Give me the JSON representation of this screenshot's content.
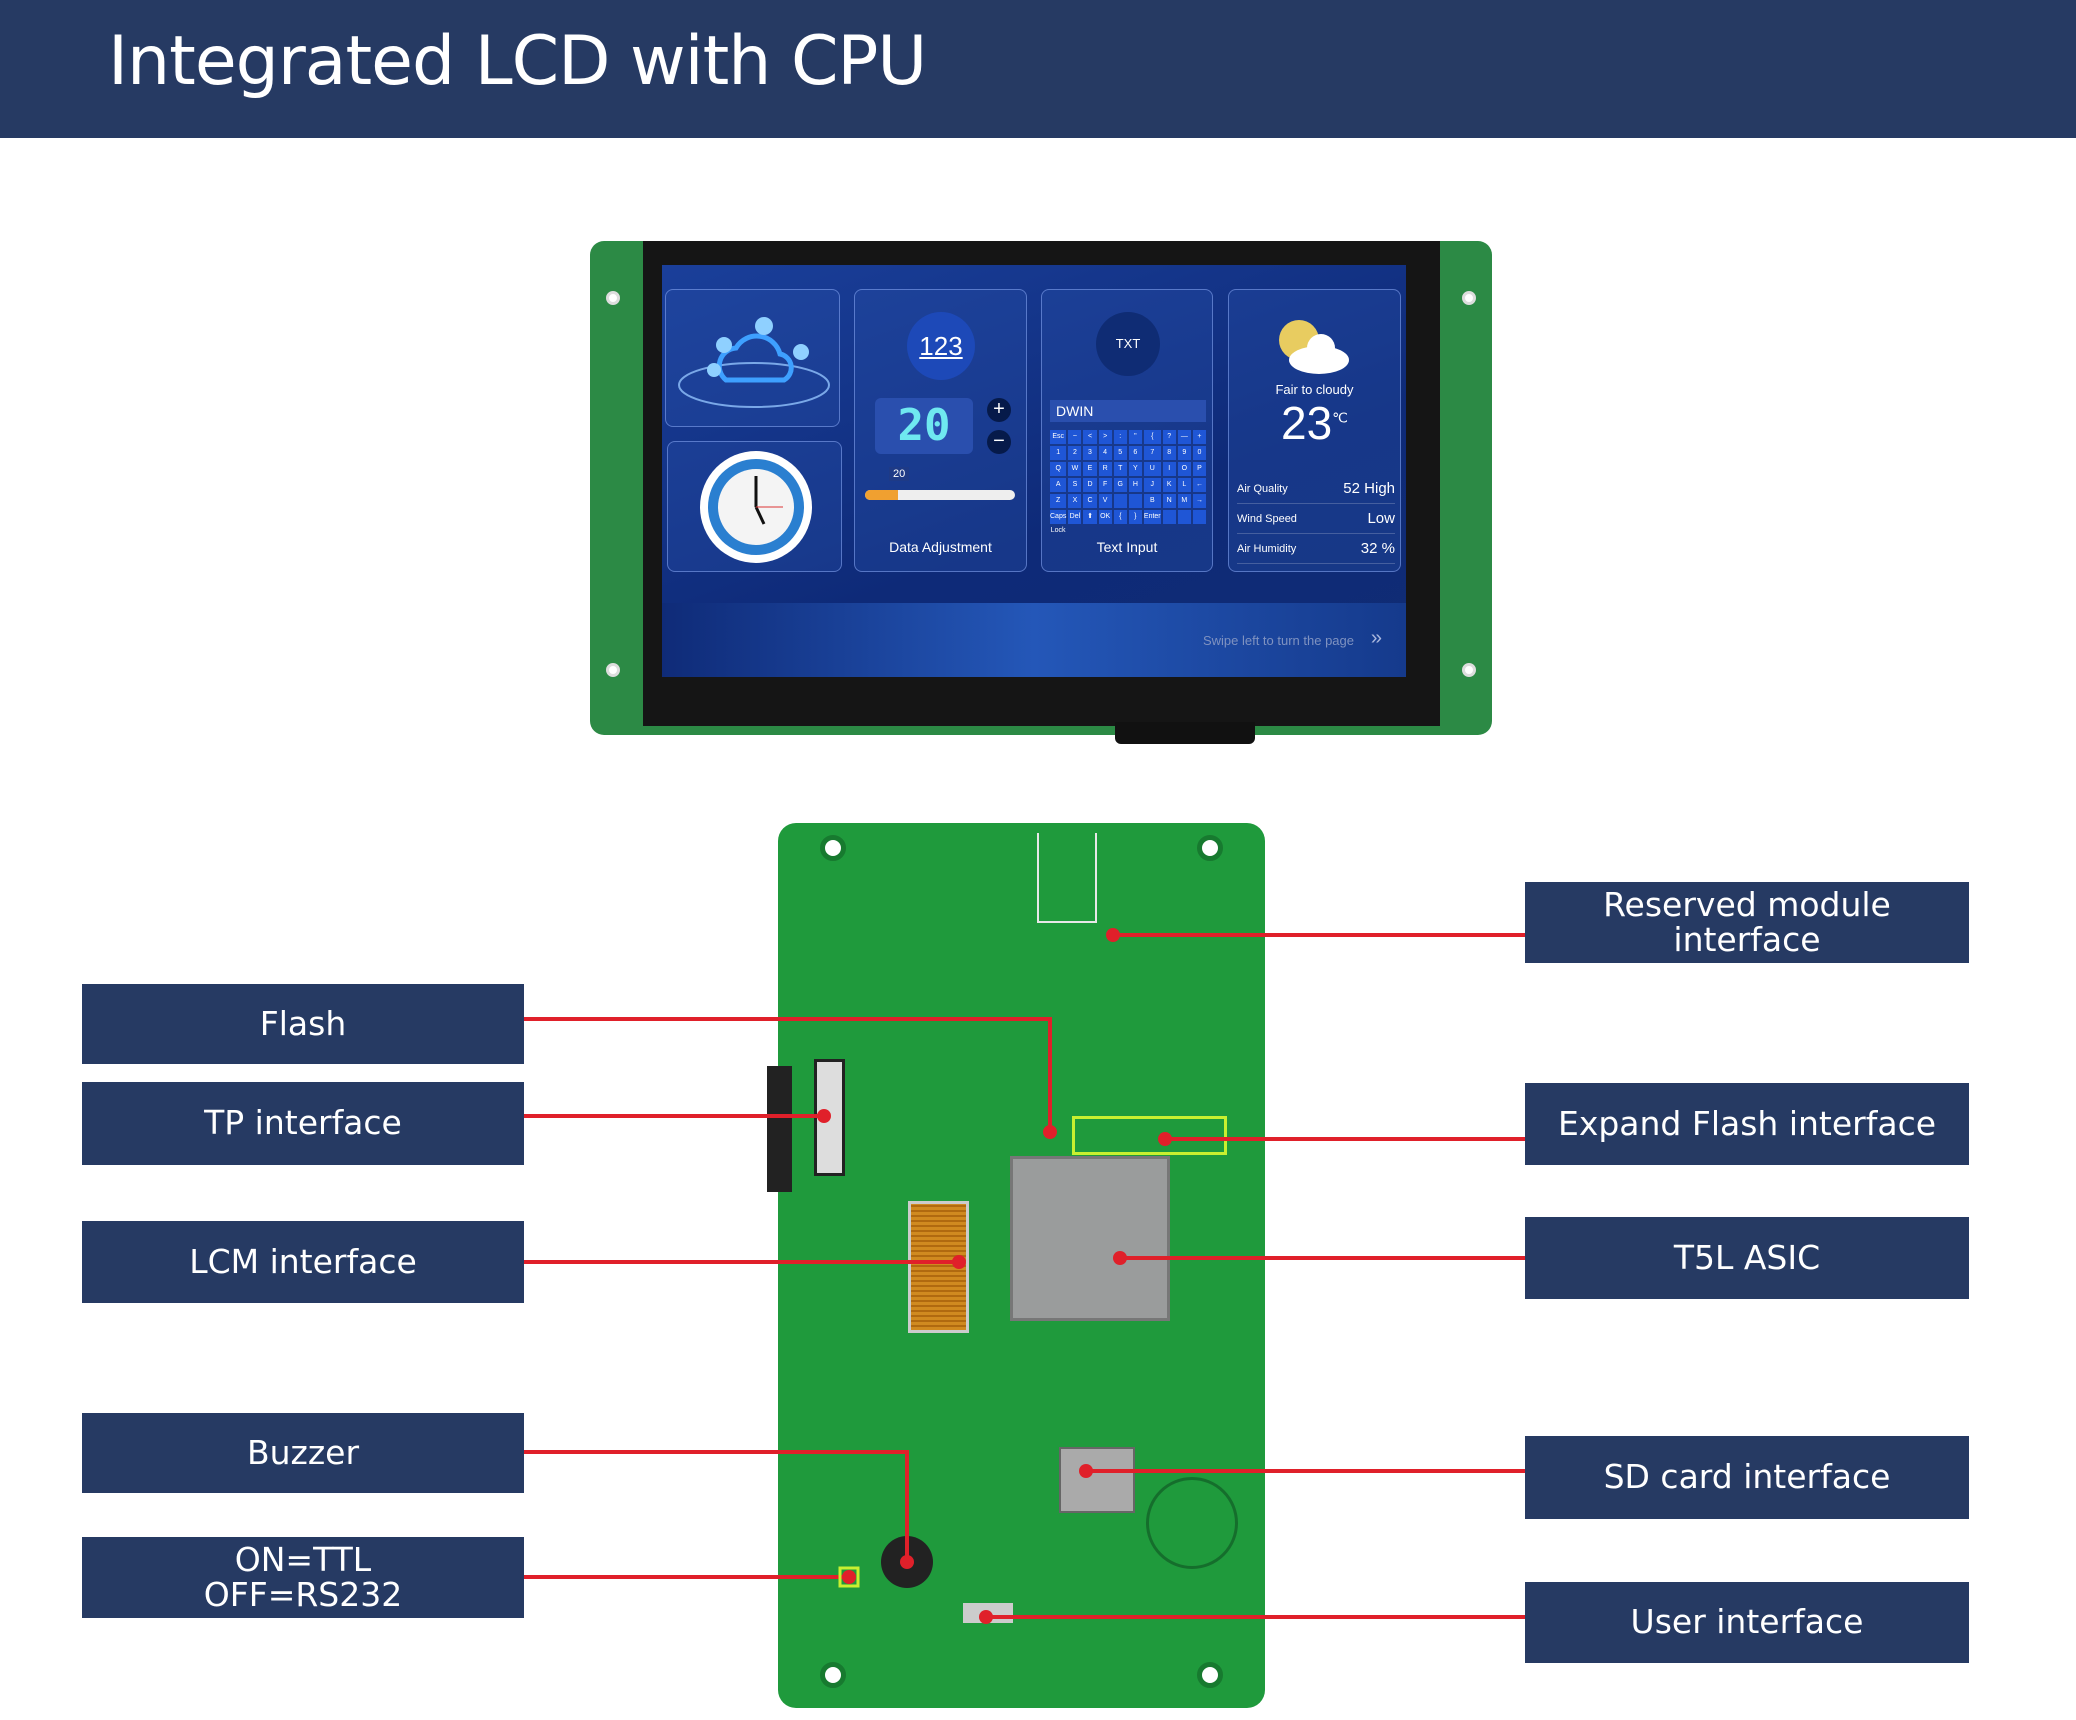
{
  "title": "Integrated LCD with CPU",
  "screen": {
    "data_adjustment": {
      "icon_text": "123",
      "value": "20",
      "slider_value": "20",
      "slider_fraction": 0.22,
      "label": "Data Adjustment"
    },
    "text_input": {
      "icon_text": "TXT",
      "field_value": "DWIN",
      "label": "Text Input",
      "keys": [
        "Esc",
        "~",
        "<",
        ">",
        ":",
        "\"",
        "{",
        "?",
        "—",
        "+",
        "1",
        "2",
        "3",
        "4",
        "5",
        "6",
        "7",
        "8",
        "9",
        "0",
        "Q",
        "W",
        "E",
        "R",
        "T",
        "Y",
        "U",
        "I",
        "O",
        "P",
        "A",
        "S",
        "D",
        "F",
        "G",
        "H",
        "J",
        "K",
        "L",
        "←",
        "Z",
        "X",
        "C",
        "V",
        "",
        "",
        "B",
        "N",
        "M",
        "→",
        "Caps Lock",
        "Del",
        "⬆",
        "OK",
        "{",
        "}",
        "Enter",
        "",
        "",
        ""
      ]
    },
    "weather": {
      "condition": "Fair to cloudy",
      "temperature": "23",
      "unit": "℃",
      "rows": [
        {
          "label": "Air Quality",
          "value": "52 High"
        },
        {
          "label": "Wind Speed",
          "value": "Low"
        },
        {
          "label": "Air Humidity",
          "value": "32 %"
        }
      ]
    },
    "swipe_hint": "Swipe left to turn the page"
  },
  "labels_left": [
    "Flash",
    "TP interface",
    "LCM interface",
    "Buzzer",
    "ON=TTL\nOFF=RS232"
  ],
  "labels_right": [
    "Reserved module interface",
    "Expand Flash interface",
    "T5L ASIC",
    "SD card interface",
    "User interface"
  ],
  "colors": {
    "header": "#263a63",
    "leader": "#e0202a",
    "pcb": "#1f9a3c",
    "highlight": "#c8f030"
  }
}
